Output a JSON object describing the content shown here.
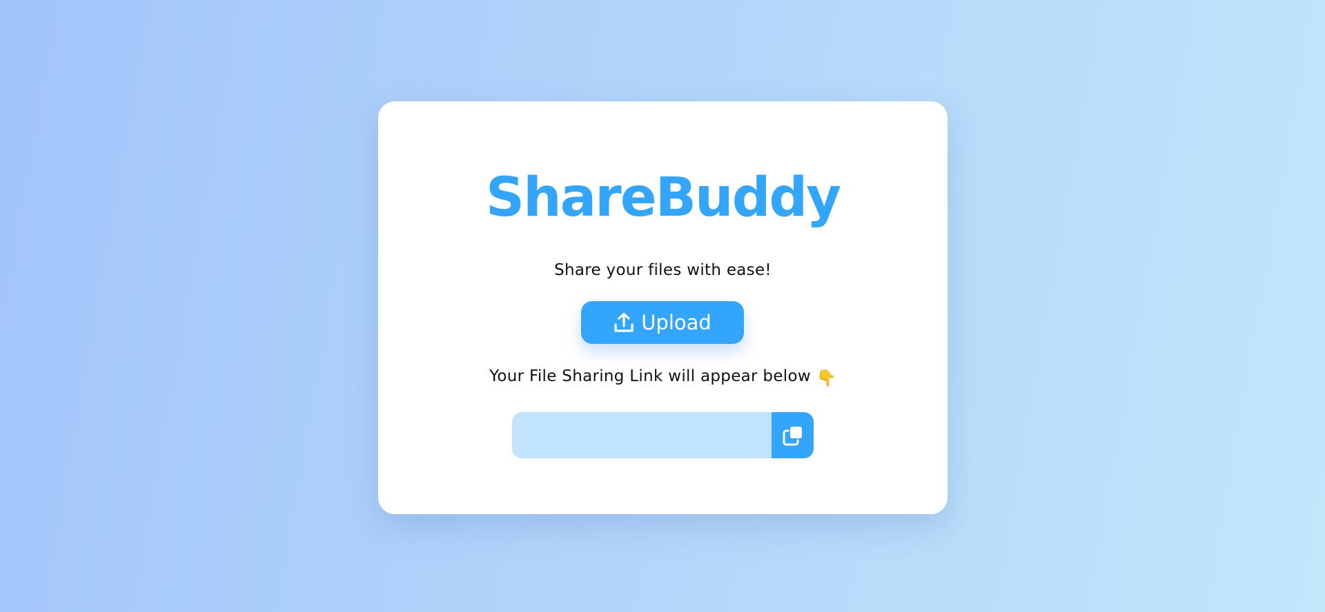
{
  "app": {
    "logo_text": "ShareBuddy",
    "tagline": "Share your files with ease!"
  },
  "upload": {
    "label": "Upload",
    "icon": "upload-icon"
  },
  "link": {
    "hint": "Your File Sharing Link will appear below",
    "hint_emoji": "👇",
    "value": "",
    "copy_icon": "copy-icon"
  },
  "colors": {
    "accent": "#33a5fb",
    "input_background": "#c2e3fd",
    "card_background": "#ffffff"
  }
}
